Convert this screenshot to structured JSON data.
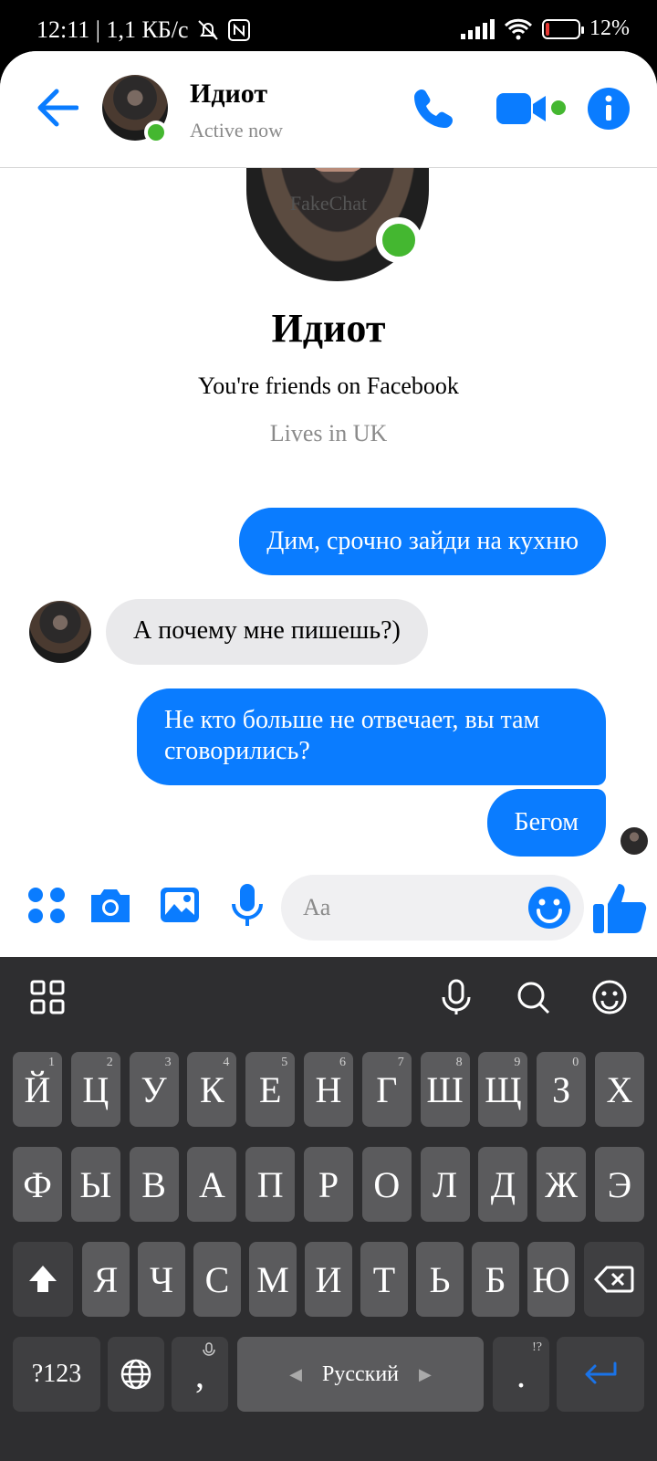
{
  "status_bar": {
    "time_and_speed": "12:11 | 1,1 КБ/с",
    "battery": "12%",
    "battery_level": 0.12
  },
  "header": {
    "name": "Идиот",
    "status": "Active now"
  },
  "watermark": "FakeChat",
  "profile": {
    "name": "Идиот",
    "friends": "You're friends on Facebook",
    "lives": "Lives in UK"
  },
  "messages": [
    {
      "direction": "outgoing",
      "text": "Дим, срочно зайди на кухню"
    },
    {
      "direction": "incoming",
      "text": "А почему мне пишешь?)"
    },
    {
      "direction": "outgoing",
      "text": "Не кто больше не отвечает, вы там сговорились?"
    },
    {
      "direction": "outgoing",
      "text": "Бегом"
    }
  ],
  "composer": {
    "placeholder": "Aa"
  },
  "keyboard": {
    "row1": [
      "Й",
      "Ц",
      "У",
      "К",
      "Е",
      "Н",
      "Г",
      "Ш",
      "Щ",
      "З",
      "Х"
    ],
    "row1_hints": [
      "1",
      "2",
      "3",
      "4",
      "5",
      "6",
      "7",
      "8",
      "9",
      "0",
      ""
    ],
    "row2": [
      "Ф",
      "Ы",
      "В",
      "А",
      "П",
      "Р",
      "О",
      "Л",
      "Д",
      "Ж",
      "Э"
    ],
    "row3": [
      "Я",
      "Ч",
      "С",
      "М",
      "И",
      "Т",
      "Ь",
      "Б",
      "Ю"
    ],
    "symbols_label": "?123",
    "comma": ",",
    "space_label": "Русский",
    "period": ".",
    "period_hint": "!?"
  },
  "colors": {
    "accent": "#0a7cff",
    "online": "#44b730",
    "incoming_bubble": "#e9e9eb",
    "keyboard_bg": "#2e2e30",
    "key_bg": "#5b5b5d"
  }
}
